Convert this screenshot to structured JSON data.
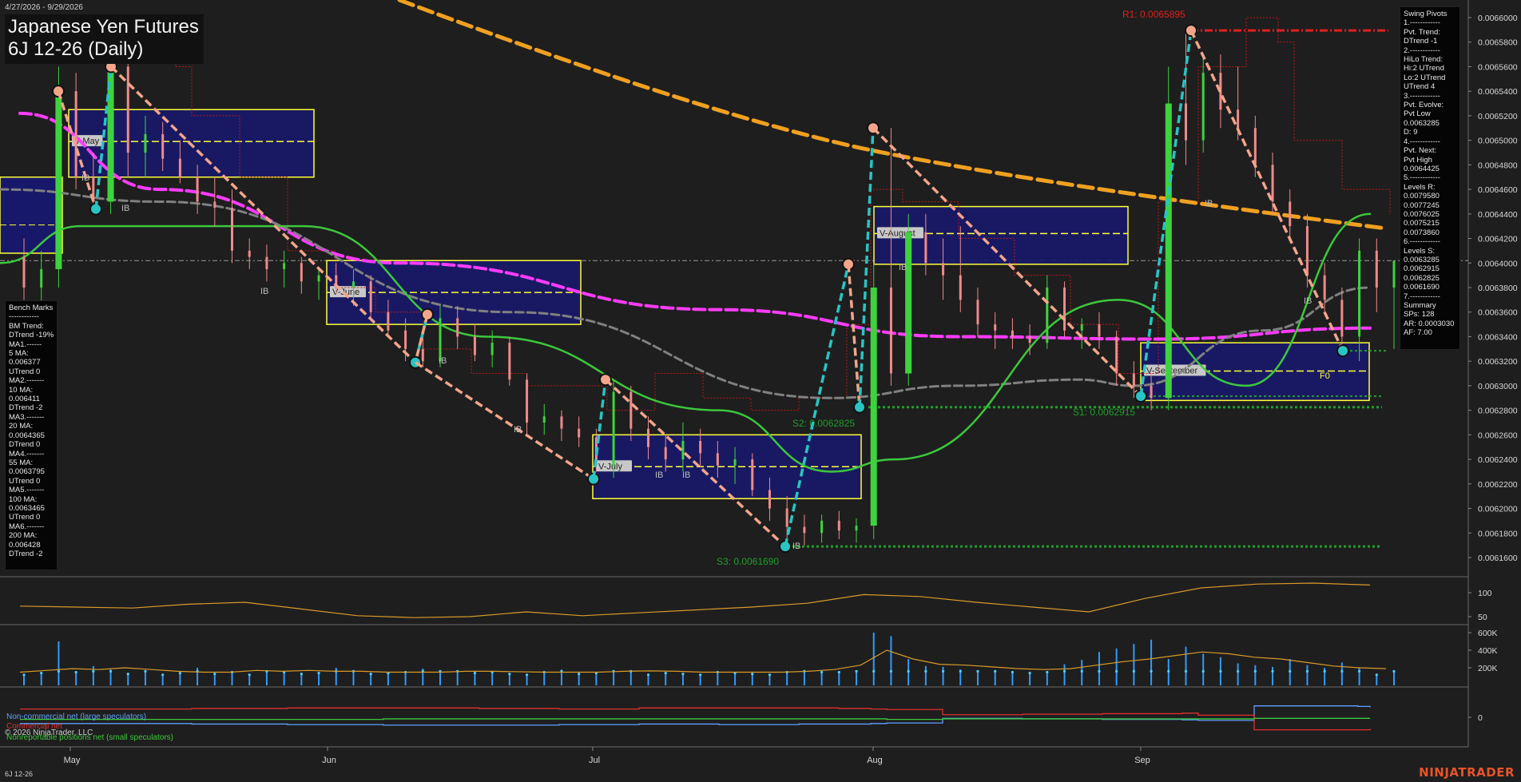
{
  "header": {
    "date_range": "4/27/2026 - 9/29/2026",
    "title_line1": "Japanese Yen Futures",
    "title_line2": "6J 12-26 (Daily)"
  },
  "swing_pivots_panel": {
    "lines": [
      "Swing Pivots",
      "1.------------",
      "Pvt. Trend:",
      "DTrend -1",
      "2.------------",
      "HiLo Trend:",
      "Hi:2 UTrend",
      "Lo:2 UTrend",
      "UTrend 4",
      "3.------------",
      "Pvt. Evolve:",
      "Pvt Low",
      "0.0063285",
      "D: 9",
      "4.------------",
      "Pvt. Next:",
      "Pvt High",
      "0.0064425",
      "5.------------",
      "Levels R:",
      "0.0079580",
      "0.0077245",
      "0.0076025",
      "0.0075215",
      "0.0073860",
      "6.------------",
      "Levels S:",
      "0.0063285",
      "0.0062915",
      "0.0062825",
      "0.0061690",
      "7.------------",
      "Summary",
      "SPs: 128",
      "AR: 0.0003030",
      "AF: 7.00"
    ]
  },
  "benchmarks_panel": {
    "lines": [
      "Bench Marks",
      "------------",
      "BM Trend:",
      "DTrend -19%",
      "MA1.------",
      "5 MA:",
      "0.006377",
      "UTrend 0",
      "MA2.-------",
      "10 MA:",
      "0.006411",
      "DTrend -2",
      "MA3.-------",
      "20 MA:",
      "0.0064365",
      "DTrend 0",
      "MA4.-------",
      "55 MA:",
      "0.0063795",
      "UTrend 0",
      "MA5.-------",
      "100 MA:",
      "0.0063465",
      "UTrend 0",
      "MA6.-------",
      "200 MA:",
      "0.006428",
      "DTrend -2"
    ]
  },
  "labels": {
    "r1": "R1: 0.0065895",
    "s1": "S1: 0.0062915",
    "s2": "S2: 0.0062825",
    "s3": "S3: 0.0061690",
    "ib": "IB",
    "fo": "F0",
    "vwap_may": "V-May",
    "vwap_june": "V-June",
    "vwap_july": "V-July",
    "vwap_august": "V-August",
    "vwap_september": "V-September"
  },
  "cot_legend": {
    "large": "Non-commercial net (large speculators)",
    "commercial": "Commercial net",
    "small": "Nonreportable positions net (small speculators)"
  },
  "copyright": "© 2026 NinjaTrader, LLC",
  "footer_symbol": "6J 12-26",
  "brand": "NINJATRADER",
  "colors": {
    "background": "#1e1e1e",
    "up_candle": "#3ed33e",
    "down_candle": "#f08a8a",
    "swing_up": "#29c4c4",
    "swing_down": "#f3a58a",
    "ma200": "#f0a020",
    "ma100": "#ff3cff",
    "ma55": "#808080",
    "ma20": "#3cc83c",
    "resistance": "#e02020",
    "support": "#1f9e2a",
    "vwap_box": "#ffff3c",
    "vwap_fill": "#18186a",
    "volume": "#2f9bff",
    "brand": "#e8532a"
  },
  "chart_data": [
    {
      "type": "candlestick",
      "title": "Japanese Yen Futures 6J 12-26 (Daily)",
      "x_tick_labels": [
        "May",
        "Jun",
        "Jul",
        "Aug",
        "Sep"
      ],
      "y_tick_labels": [
        "0.0066000",
        "0.0065800",
        "0.0065600",
        "0.0065400",
        "0.0065200",
        "0.0065000",
        "0.0064800",
        "0.0064600",
        "0.0064400",
        "0.0064200",
        "0.0064000",
        "0.0063800",
        "0.0063600",
        "0.0063400",
        "0.0063200",
        "0.0063000",
        "0.0062800",
        "0.0062600",
        "0.0062400",
        "0.0062200",
        "0.0062000",
        "0.0061800",
        "0.0061600"
      ],
      "ylim": [
        0.006148,
        0.006604
      ],
      "current_price": 0.006402,
      "grid": false,
      "candles": [
        [
          0.006405,
          0.00642,
          0.00637,
          0.00638
        ],
        [
          0.00638,
          0.00641,
          0.00636,
          0.006395
        ],
        [
          0.006395,
          0.00656,
          0.00638,
          0.00654
        ],
        [
          0.00654,
          0.006555,
          0.00646,
          0.00647
        ],
        [
          0.00647,
          0.00649,
          0.00644,
          0.00645
        ],
        [
          0.00645,
          0.00658,
          0.00644,
          0.00656
        ],
        [
          0.00656,
          0.006565,
          0.00647,
          0.00649
        ],
        [
          0.00649,
          0.00652,
          0.00647,
          0.006505
        ],
        [
          0.006505,
          0.006515,
          0.006475,
          0.006485
        ],
        [
          0.006485,
          0.0065,
          0.006465,
          0.00647
        ],
        [
          0.00647,
          0.00648,
          0.00644,
          0.00645
        ],
        [
          0.00645,
          0.00647,
          0.00643,
          0.006445
        ],
        [
          0.006445,
          0.00646,
          0.0064,
          0.00641
        ],
        [
          0.00641,
          0.00642,
          0.006395,
          0.006405
        ],
        [
          0.006405,
          0.006415,
          0.006385,
          0.006395
        ],
        [
          0.006395,
          0.00641,
          0.00638,
          0.0064
        ],
        [
          0.0064,
          0.006405,
          0.006375,
          0.006385
        ],
        [
          0.006385,
          0.006395,
          0.00637,
          0.00639
        ],
        [
          0.00639,
          0.0064,
          0.006375,
          0.00638
        ],
        [
          0.00638,
          0.006395,
          0.006365,
          0.006385
        ],
        [
          0.006385,
          0.00639,
          0.006355,
          0.00636
        ],
        [
          0.00636,
          0.00637,
          0.00634,
          0.006345
        ],
        [
          0.006345,
          0.006355,
          0.00632,
          0.00633
        ],
        [
          0.00633,
          0.006345,
          0.006315,
          0.00632
        ],
        [
          0.00632,
          0.006365,
          0.006315,
          0.006355
        ],
        [
          0.006355,
          0.006365,
          0.00633,
          0.00634
        ],
        [
          0.00634,
          0.00635,
          0.00632,
          0.006325
        ],
        [
          0.006325,
          0.006345,
          0.006315,
          0.006335
        ],
        [
          0.006335,
          0.00634,
          0.0063,
          0.006305
        ],
        [
          0.006305,
          0.00631,
          0.00626,
          0.00627
        ],
        [
          0.00627,
          0.006285,
          0.00626,
          0.006275
        ],
        [
          0.006275,
          0.00628,
          0.006255,
          0.006265
        ],
        [
          0.006265,
          0.006275,
          0.00625,
          0.006258
        ],
        [
          0.006258,
          0.006265,
          0.00623,
          0.006235
        ],
        [
          0.006235,
          0.006305,
          0.006225,
          0.006295
        ],
        [
          0.006295,
          0.0063,
          0.006255,
          0.006265
        ],
        [
          0.006265,
          0.006275,
          0.00624,
          0.00625
        ],
        [
          0.00625,
          0.00626,
          0.00623,
          0.00624
        ],
        [
          0.00624,
          0.00627,
          0.00623,
          0.006255
        ],
        [
          0.006255,
          0.006265,
          0.006235,
          0.006245
        ],
        [
          0.006245,
          0.006255,
          0.006225,
          0.006235
        ],
        [
          0.006235,
          0.00625,
          0.00622,
          0.00624
        ],
        [
          0.00624,
          0.006245,
          0.00621,
          0.006215
        ],
        [
          0.006215,
          0.006225,
          0.00619,
          0.0062
        ],
        [
          0.0062,
          0.00621,
          0.006175,
          0.006185
        ],
        [
          0.006185,
          0.006195,
          0.00617,
          0.00618
        ],
        [
          0.00618,
          0.006195,
          0.006172,
          0.00619
        ],
        [
          0.00619,
          0.006198,
          0.006175,
          0.006182
        ],
        [
          0.006182,
          0.006192,
          0.006172,
          0.006186
        ],
        [
          0.006186,
          0.0064,
          0.006175,
          0.00638
        ],
        [
          0.00638,
          0.00651,
          0.0063,
          0.00631
        ],
        [
          0.00631,
          0.00644,
          0.0063,
          0.006425
        ],
        [
          0.006425,
          0.00644,
          0.00639,
          0.0064
        ],
        [
          0.0064,
          0.00642,
          0.00637,
          0.00639
        ],
        [
          0.00639,
          0.00643,
          0.00636,
          0.00637
        ],
        [
          0.00637,
          0.00638,
          0.00634,
          0.00635
        ],
        [
          0.00635,
          0.00636,
          0.00633,
          0.006345
        ],
        [
          0.006345,
          0.006355,
          0.00633,
          0.00634
        ],
        [
          0.00634,
          0.00635,
          0.006325,
          0.006335
        ],
        [
          0.006335,
          0.00639,
          0.00633,
          0.00638
        ],
        [
          0.00638,
          0.006385,
          0.00634,
          0.006345
        ],
        [
          0.006345,
          0.006355,
          0.00633,
          0.00635
        ],
        [
          0.00635,
          0.00636,
          0.00633,
          0.00634
        ],
        [
          0.00634,
          0.006345,
          0.0063,
          0.00631
        ],
        [
          0.00631,
          0.00632,
          0.00629,
          0.0063
        ],
        [
          0.0063,
          0.00631,
          0.00628,
          0.00629
        ],
        [
          0.00629,
          0.00656,
          0.00628,
          0.00653
        ],
        [
          0.00653,
          0.00659,
          0.00648,
          0.0065
        ],
        [
          0.0065,
          0.00657,
          0.00649,
          0.006555
        ],
        [
          0.006555,
          0.00657,
          0.00651,
          0.006525
        ],
        [
          0.006525,
          0.00656,
          0.0065,
          0.00651
        ],
        [
          0.00651,
          0.00652,
          0.00647,
          0.00648
        ],
        [
          0.00648,
          0.00649,
          0.00644,
          0.00645
        ],
        [
          0.00645,
          0.00646,
          0.00642,
          0.00643
        ],
        [
          0.00643,
          0.00644,
          0.00638,
          0.00639
        ],
        [
          0.00639,
          0.0064,
          0.00636,
          0.00637
        ],
        [
          0.00637,
          0.00638,
          0.00633,
          0.00634
        ],
        [
          0.00634,
          0.00642,
          0.00632,
          0.00641
        ],
        [
          0.00641,
          0.00642,
          0.00636,
          0.00638
        ],
        [
          0.00638,
          0.0064,
          0.00633,
          0.006402
        ]
      ],
      "swing_points": [
        {
          "label": "Pvt High",
          "value": 0.00654
        },
        {
          "label": "Pvt Low",
          "value": 0.006444
        },
        {
          "label": "Pvt High",
          "value": 0.00656
        },
        {
          "label": "Pvt Low",
          "value": 0.006319
        },
        {
          "label": "Pvt High",
          "value": 0.006358
        },
        {
          "label": "Pvt Low",
          "value": 0.006319
        },
        {
          "label": "Pvt Low",
          "value": 0.006224
        },
        {
          "label": "Pvt High",
          "value": 0.006305
        },
        {
          "label": "Pvt Low",
          "value": 0.006169
        },
        {
          "label": "Pvt High",
          "value": 0.006399
        },
        {
          "label": "Pvt Low",
          "value": 0.0062825
        },
        {
          "label": "Pvt High",
          "value": 0.00651
        },
        {
          "label": "Pvt Low",
          "value": 0.0062915
        },
        {
          "label": "Pvt High",
          "value": 0.0065895
        },
        {
          "label": "Pvt Low",
          "value": 0.0063285
        }
      ],
      "levels": {
        "R1": 0.0065895,
        "S1": 0.0062915,
        "S2": 0.0062825,
        "S3": 0.006169
      },
      "vwap_periods": [
        {
          "name": "V-May",
          "high": 0.006525,
          "low": 0.00647,
          "vwap": 0.006499
        },
        {
          "name": "V-June",
          "high": 0.006402,
          "low": 0.00635,
          "vwap": 0.006376
        },
        {
          "name": "V-July",
          "high": 0.00626,
          "low": 0.006208,
          "vwap": 0.006234
        },
        {
          "name": "V-August",
          "high": 0.006446,
          "low": 0.006399,
          "vwap": 0.006424
        },
        {
          "name": "V-September",
          "high": 0.006335,
          "low": 0.006288,
          "vwap": 0.006312
        }
      ],
      "moving_averages": [
        {
          "name": "200 MA",
          "values": [
            0.00664,
            0.006428
          ]
        },
        {
          "name": "100 MA",
          "values": [
            0.006522,
            0.00646,
            0.0064,
            0.006362,
            0.00634,
            0.006338,
            0.006347
          ]
        },
        {
          "name": "55 MA",
          "values": [
            0.00646,
            0.00645,
            0.00636,
            0.00629,
            0.0063,
            0.006305,
            0.0063,
            0.006345,
            0.00638
          ]
        },
        {
          "name": "20 MA",
          "values": [
            0.0064,
            0.00643,
            0.00643,
            0.00634,
            0.00628,
            0.00623,
            0.00624,
            0.00637,
            0.0063,
            0.00644
          ]
        }
      ]
    },
    {
      "type": "line",
      "title": "",
      "y_tick_labels": [
        "100",
        "50"
      ],
      "series": [
        {
          "name": "",
          "values": [
            72,
            70,
            68,
            76,
            80,
            66,
            52,
            48,
            50,
            60,
            52,
            58,
            64,
            70,
            78,
            96,
            92,
            80,
            70,
            60,
            88,
            110,
            118,
            120,
            116
          ]
        }
      ]
    },
    {
      "type": "bar",
      "title": "",
      "y_tick_labels": [
        "600K",
        "400K",
        "200K"
      ],
      "values": [
        120,
        140,
        500,
        150,
        220,
        180,
        130,
        160,
        120,
        140,
        200,
        130,
        150,
        120,
        170,
        150,
        130,
        140,
        200,
        160,
        130,
        140,
        150,
        190,
        170,
        160,
        140,
        150,
        130,
        120,
        150,
        180,
        130,
        140,
        160,
        170,
        120,
        140,
        130,
        120,
        150,
        140,
        130,
        120,
        150,
        160,
        150,
        150,
        160,
        600,
        560,
        300,
        220,
        210,
        180,
        170,
        160,
        150,
        140,
        150,
        240,
        290,
        380,
        420,
        470,
        520,
        300,
        440,
        360,
        320,
        250,
        230,
        210,
        300,
        230,
        200,
        260,
        200,
        120,
        160
      ],
      "line_values": [
        150,
        170,
        190,
        180,
        200,
        180,
        160,
        150,
        150,
        170,
        160,
        170,
        160,
        160,
        150,
        150,
        150,
        160,
        160,
        155,
        150,
        150,
        150,
        160,
        165,
        160,
        150,
        150,
        150,
        150,
        160,
        180,
        230,
        400,
        300,
        240,
        230,
        210,
        190,
        180,
        190,
        230,
        270,
        300,
        340,
        380,
        360,
        320,
        300,
        260,
        220,
        200,
        190
      ]
    },
    {
      "type": "line",
      "title": "",
      "y_tick_labels": [
        "0"
      ],
      "series": [
        {
          "name": "Non-commercial net (large speculators)",
          "values": [
            -12,
            -12,
            -13,
            -14,
            -15,
            -15,
            -14,
            -13,
            -14,
            -13,
            -13,
            -12,
            -11,
            -2,
            -3,
            -4,
            -5,
            -6,
            22,
            22,
            21,
            19
          ]
        },
        {
          "name": "Commercial net",
          "values": [
            16,
            16,
            17,
            18,
            18,
            17,
            16,
            18,
            18,
            18,
            17,
            16,
            15,
            5,
            6,
            7,
            8,
            4,
            -24,
            -24,
            -24,
            -22
          ]
        },
        {
          "name": "Nonreportable positions net (small speculators)",
          "values": [
            -4,
            -4,
            -4,
            -4,
            -3,
            -3,
            -3,
            -3,
            -3,
            -3,
            -3,
            -3,
            -4,
            -3,
            -3,
            -3,
            -3,
            -3,
            -2,
            -2,
            -2,
            -2
          ]
        }
      ]
    }
  ]
}
